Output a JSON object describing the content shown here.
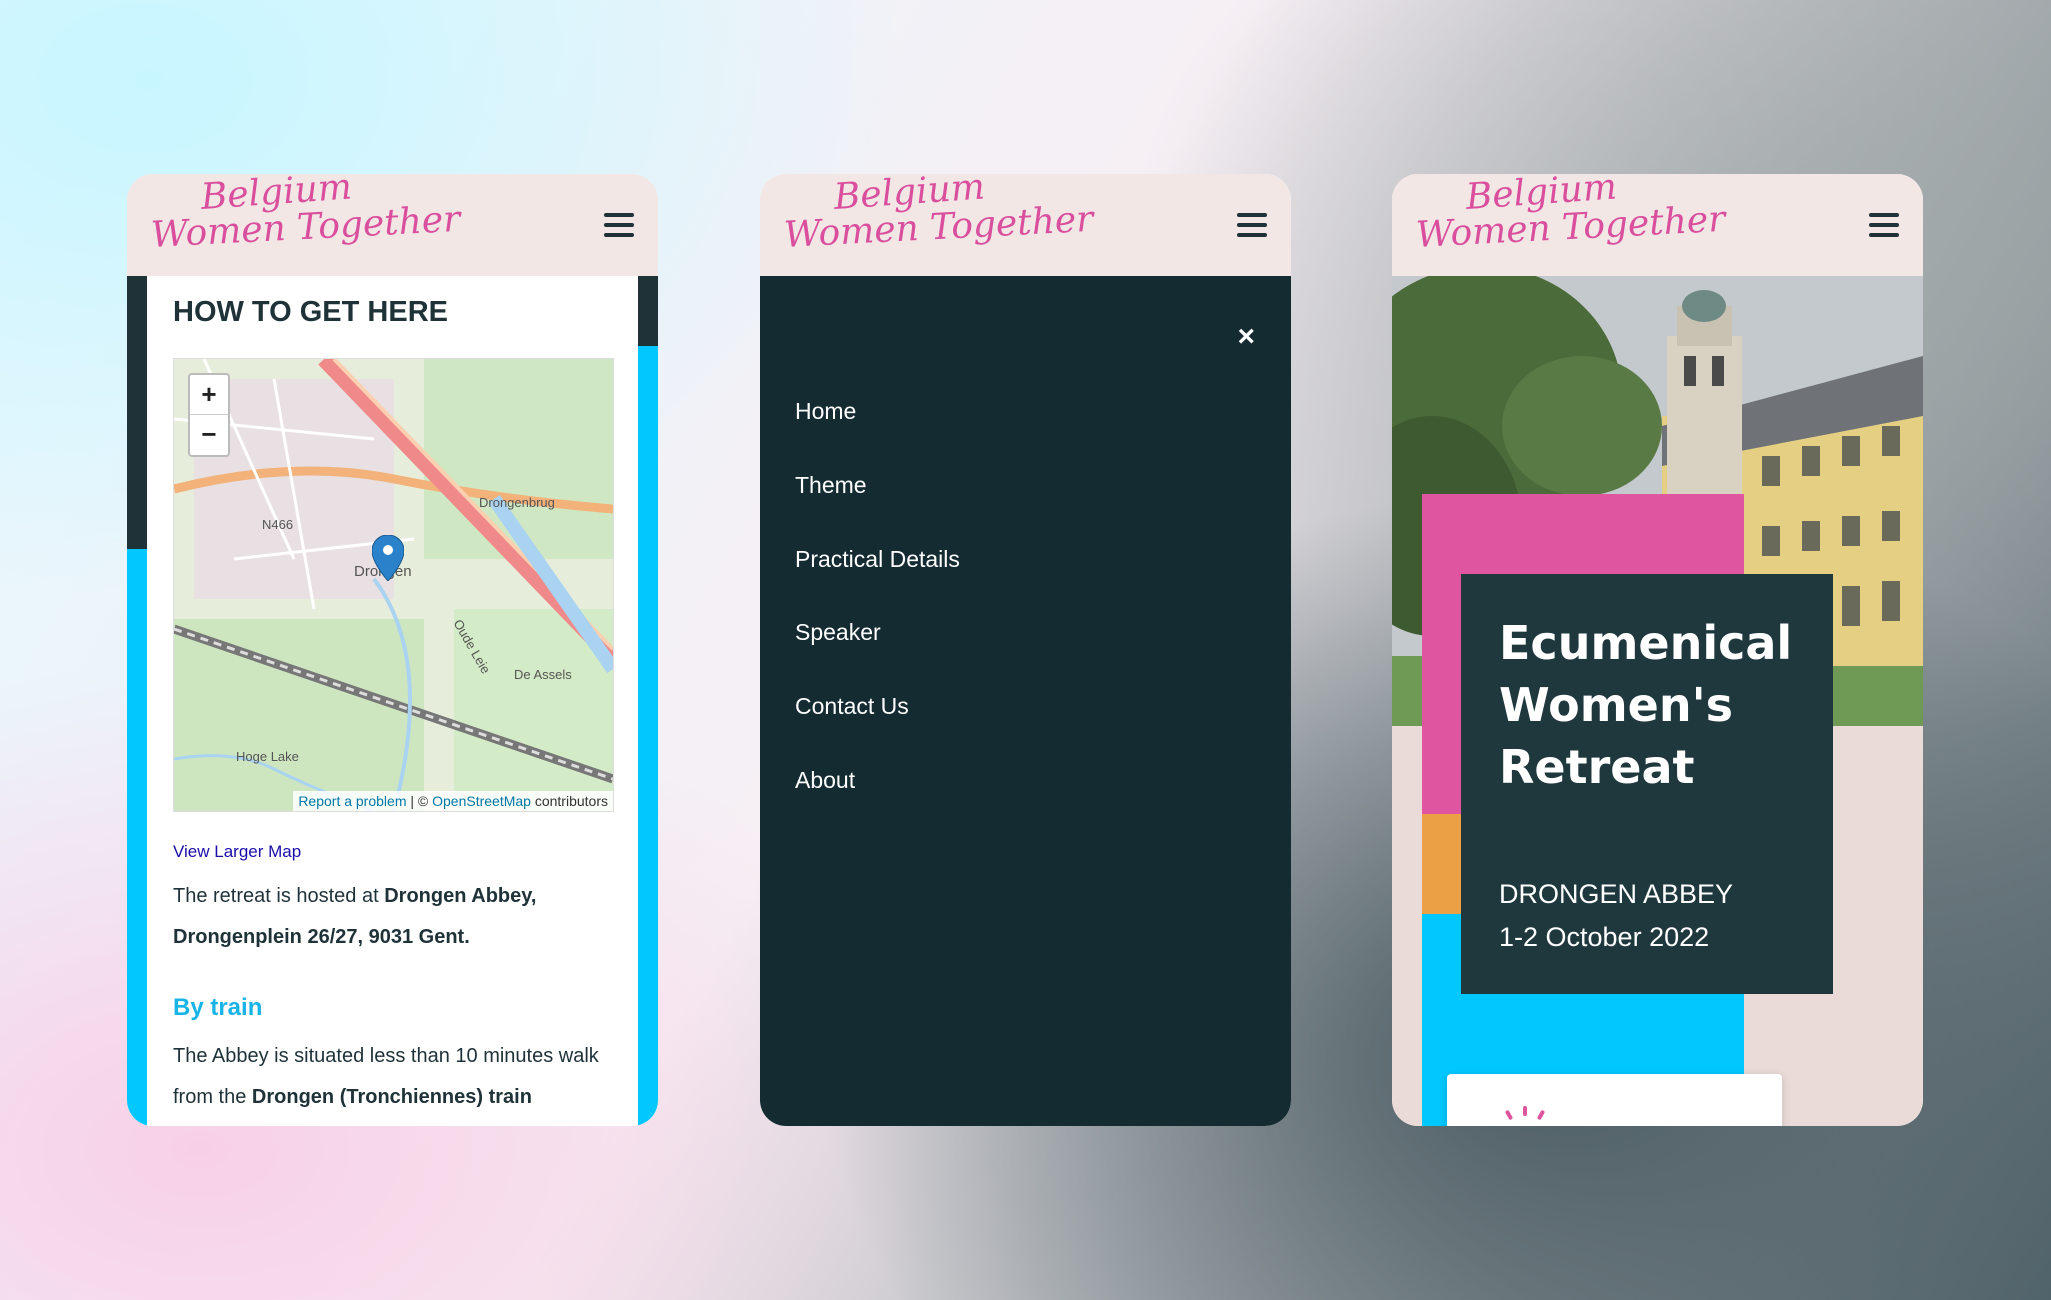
{
  "logo": {
    "line1": "Belgium",
    "line2": "Women Together"
  },
  "screen1": {
    "heading": "HOW TO GET HERE",
    "map": {
      "zoom_in": "+",
      "zoom_out": "−",
      "labels": {
        "n466": "N466",
        "drongenbrug": "Drongenbrug",
        "drongen": "Drongen",
        "deassels": "De Assels",
        "hogelake": "Hoge Lake",
        "oudeleie": "Oude Leie"
      },
      "attribution": {
        "report": "Report a problem",
        "sep": " | © ",
        "osm": "OpenStreetMap",
        "contrib": " contributors"
      }
    },
    "view_larger": "View Larger Map",
    "intro": {
      "lead": "The retreat is hosted at ",
      "place": "Drongen Abbey, Drongenplein 26/27, 9031 Gent."
    },
    "train_heading": "By train",
    "train": {
      "lead": "The Abbey is situated less than 10 minutes walk from the ",
      "station": "Drongen (Tronchiennes) train"
    }
  },
  "screen2": {
    "close": "×",
    "nav": [
      "Home",
      "Theme",
      "Practical Details",
      "Speaker",
      "Contact Us",
      "About"
    ]
  },
  "screen3": {
    "title": "Ecumenical Women's Retreat",
    "venue": "DRONGEN ABBEY",
    "dates": "1-2 October 2022"
  },
  "colors": {
    "brand_pink": "#df559f",
    "dark": "#1e3238",
    "cyan": "#00c8ff",
    "orange": "#eba046",
    "header_bg": "#f2e7e5"
  }
}
